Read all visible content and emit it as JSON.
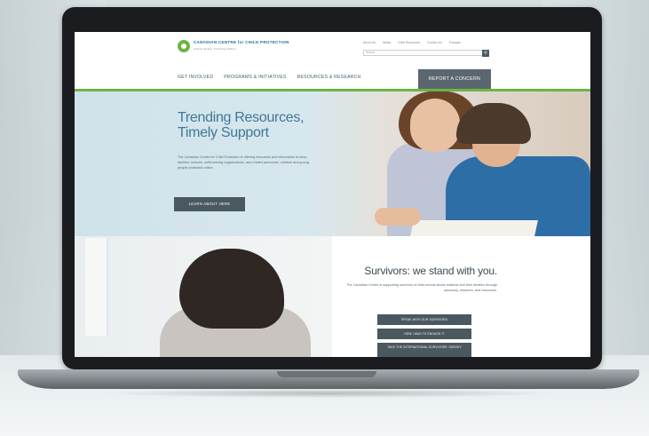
{
  "header": {
    "logo_name": "CANADIAN CENTRE for CHILD PROTECTION",
    "logo_tagline": "Helping families. Protecting children.",
    "utility_links": [
      "About Us",
      "Media",
      "Child Resources",
      "Contact Us",
      "Français"
    ],
    "search_placeholder": "Search",
    "nav_items": [
      "GET INVOLVED",
      "PROGRAMS & INITIATIVES",
      "RESOURCES & RESEARCH"
    ],
    "report_button": "REPORT A CONCERN"
  },
  "hero": {
    "title": "Trending Resources, Timely Support",
    "body": "The Canadian Centre for Child Protection is offering resources and information to keep families, schools, child-serving organizations, and related personnel, children and young people protected online.",
    "button": "LEARN ABOUT HERE"
  },
  "survivors": {
    "title": "Survivors: we stand with you.",
    "body": "The Canadian Centre is supporting survivors of child sexual abuse material and their families through advocacy, research, and resources.",
    "buttons": [
      "SPEAK WITH OUR SURVIVORS",
      "HOW I WAS TO ENGAGE IT",
      "TAKE THE INTERNATIONAL SURVIVORS' SURVEY"
    ]
  },
  "colors": {
    "brand_green": "#6bb543",
    "brand_blue": "#3f7897",
    "button_dark": "#4a5860"
  },
  "icons": {
    "search": "magnifier-icon",
    "logo": "ring-logo-icon"
  }
}
